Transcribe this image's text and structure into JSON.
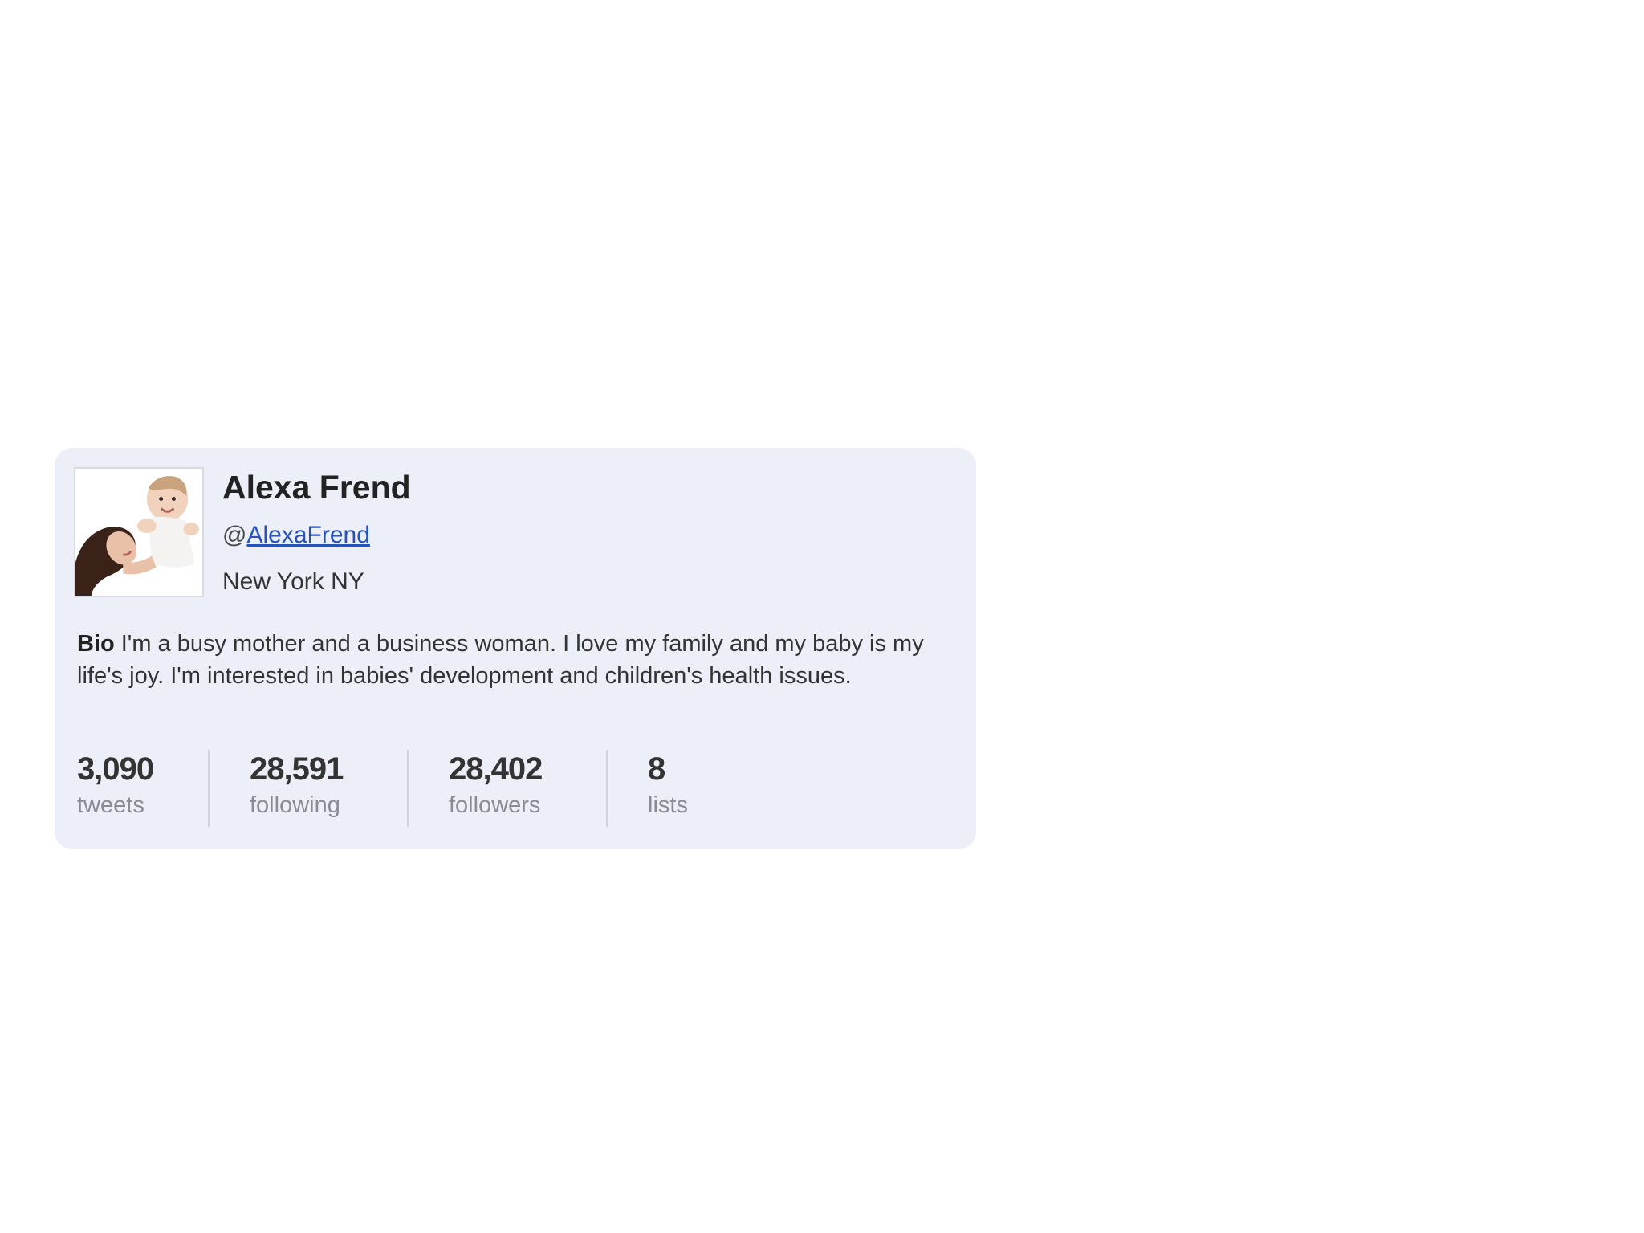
{
  "profile": {
    "name": "Alexa Frend",
    "handle_prefix": "@",
    "handle": "AlexaFrend",
    "location": "New York NY",
    "bio_label": "Bio",
    "bio_text": "I'm a busy mother and a business woman. I love my family and my baby is my life's joy. I'm interested in babies' development and children's health issues."
  },
  "stats": [
    {
      "value": "3,090",
      "label": "tweets"
    },
    {
      "value": "28,591",
      "label": "following"
    },
    {
      "value": "28,402",
      "label": "followers"
    },
    {
      "value": "8",
      "label": "lists"
    }
  ],
  "colors": {
    "card_background": "#eceef8",
    "link": "#2553b8",
    "stat_label": "#8a8c94"
  },
  "icons": {
    "avatar": "profile-photo"
  }
}
